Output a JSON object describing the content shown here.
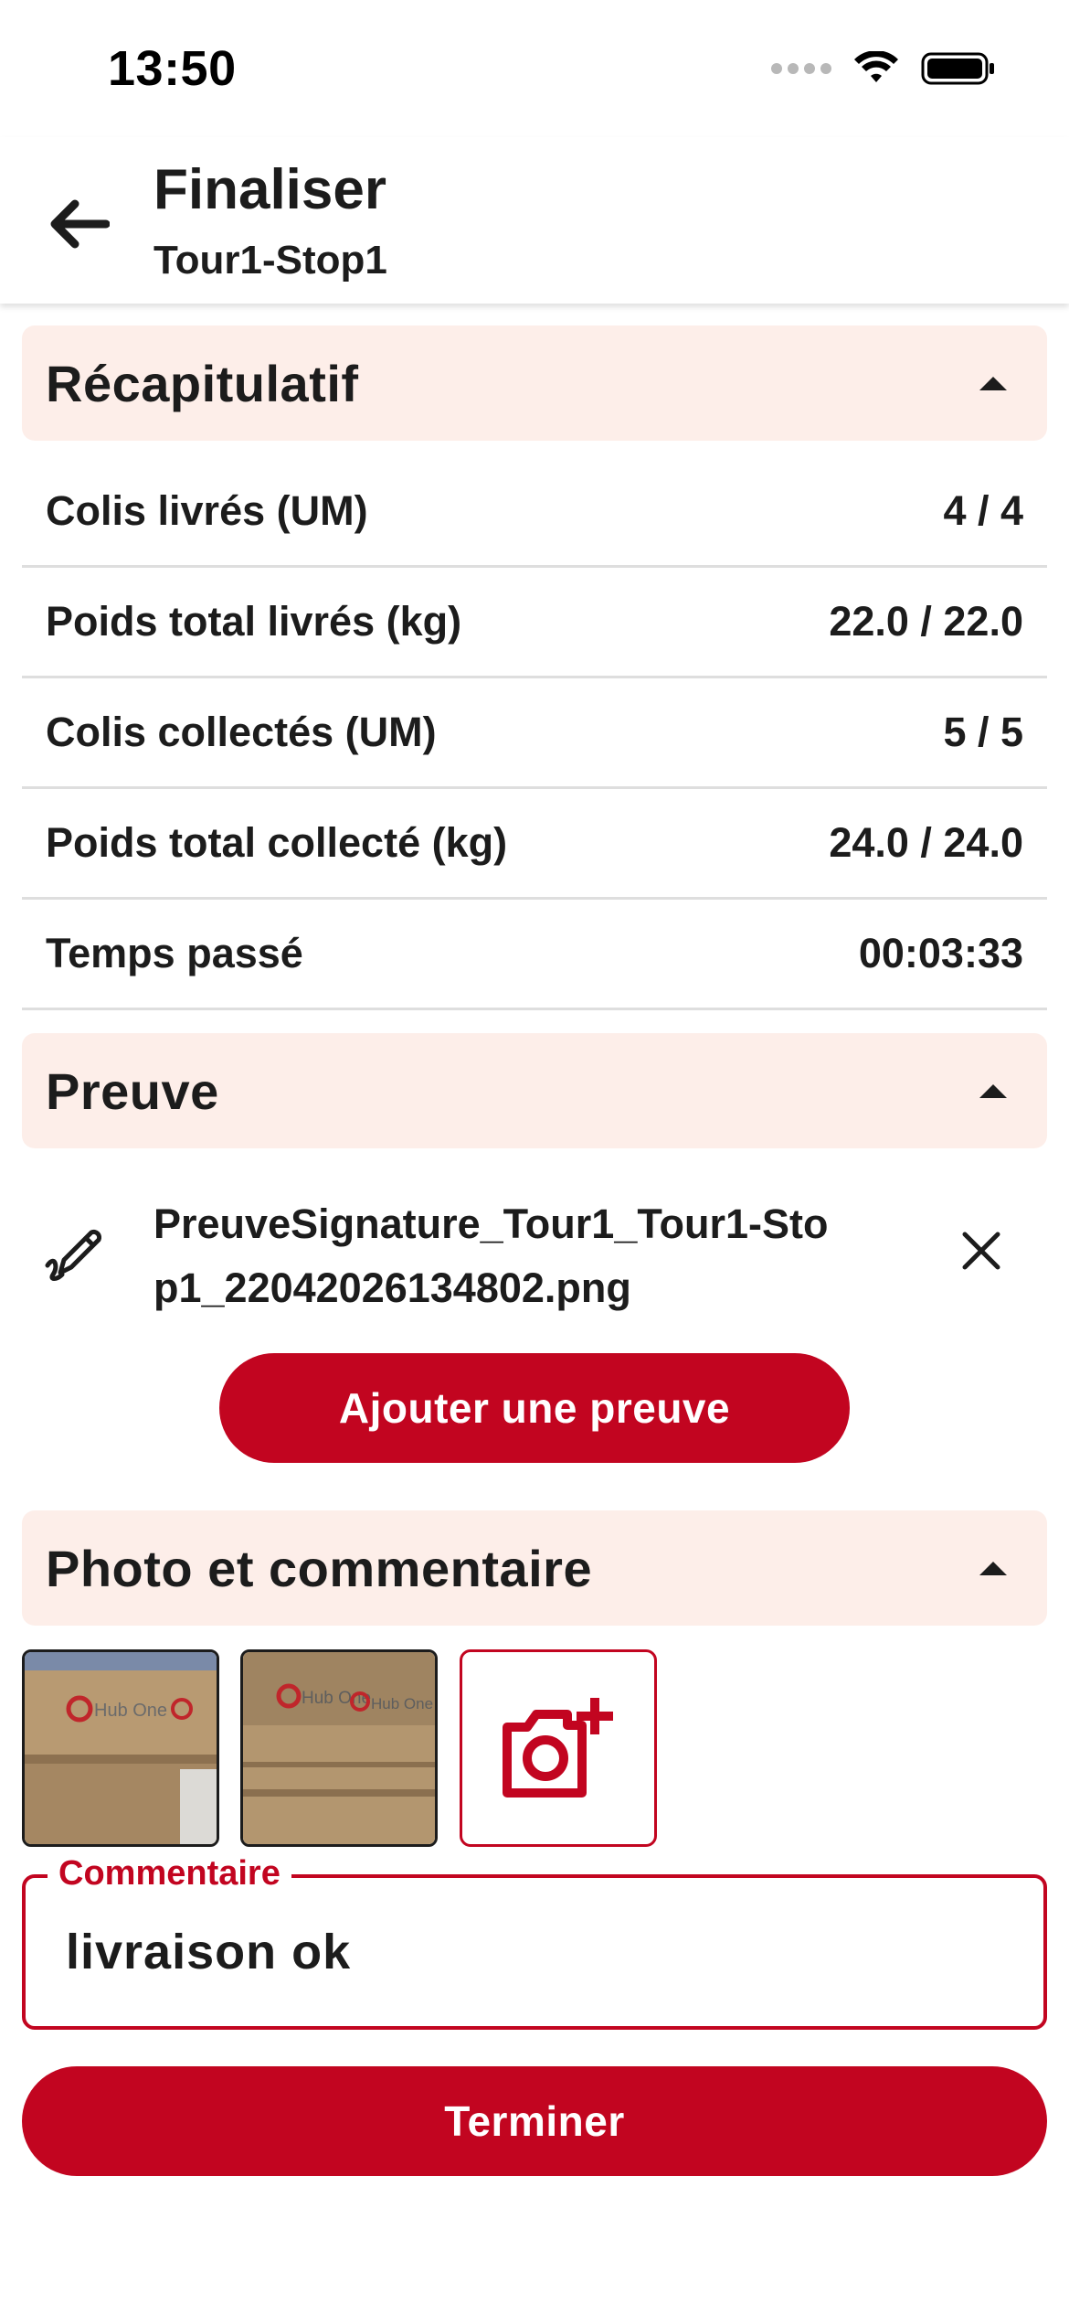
{
  "status_bar": {
    "time": "13:50"
  },
  "header": {
    "title": "Finaliser",
    "subtitle": "Tour1-Stop1"
  },
  "sections": {
    "summary_title": "Récapitulatif",
    "proof_title": "Preuve",
    "photo_title": "Photo et commentaire"
  },
  "summary": [
    {
      "label": "Colis livrés (UM)",
      "value": "4 / 4"
    },
    {
      "label": "Poids total livrés (kg)",
      "value": "22.0 / 22.0"
    },
    {
      "label": "Colis collectés (UM)",
      "value": "5 / 5"
    },
    {
      "label": "Poids total collecté (kg)",
      "value": "24.0 / 24.0"
    },
    {
      "label": "Temps passé",
      "value": "00:03:33"
    }
  ],
  "proof": {
    "filename": "PreuveSignature_Tour1_Tour1-Stop1_22042026134802.png",
    "add_label": "Ajouter une preuve"
  },
  "photos": {
    "thumb_text": "Hub One"
  },
  "comment": {
    "label": "Commentaire",
    "value": "livraison ok"
  },
  "actions": {
    "finish_label": "Terminer"
  },
  "colors": {
    "accent": "#c20520",
    "section_bg": "#fdeee9"
  },
  "icons": [
    "back-arrow-icon",
    "chevron-up-icon",
    "pen-icon",
    "close-icon",
    "camera-add-icon",
    "wifi-icon",
    "battery-icon",
    "signal-icon"
  ]
}
